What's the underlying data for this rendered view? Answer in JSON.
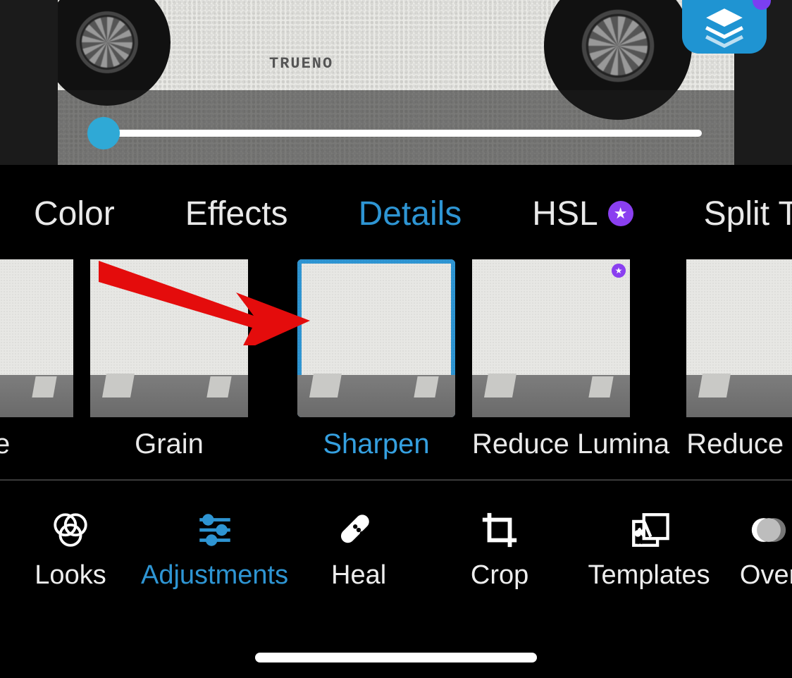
{
  "preview": {
    "brand_text": "TRUENO"
  },
  "slider": {
    "value": 0
  },
  "tabs": {
    "items": [
      {
        "label": "Color"
      },
      {
        "label": "Effects"
      },
      {
        "label": "Details"
      },
      {
        "label": "HSL"
      },
      {
        "label": "Split Tone"
      }
    ],
    "active_index": 2
  },
  "presets": {
    "items": [
      {
        "label": "de"
      },
      {
        "label": "Grain"
      },
      {
        "label": "Sharpen"
      },
      {
        "label": "Reduce Lumina"
      },
      {
        "label": "Reduce Colo"
      }
    ],
    "active_index": 2
  },
  "toolbar": {
    "items": [
      {
        "label": "Looks"
      },
      {
        "label": "Adjustments"
      },
      {
        "label": "Heal"
      },
      {
        "label": "Crop"
      },
      {
        "label": "Templates"
      },
      {
        "label": "Over"
      }
    ],
    "active_index": 1
  }
}
